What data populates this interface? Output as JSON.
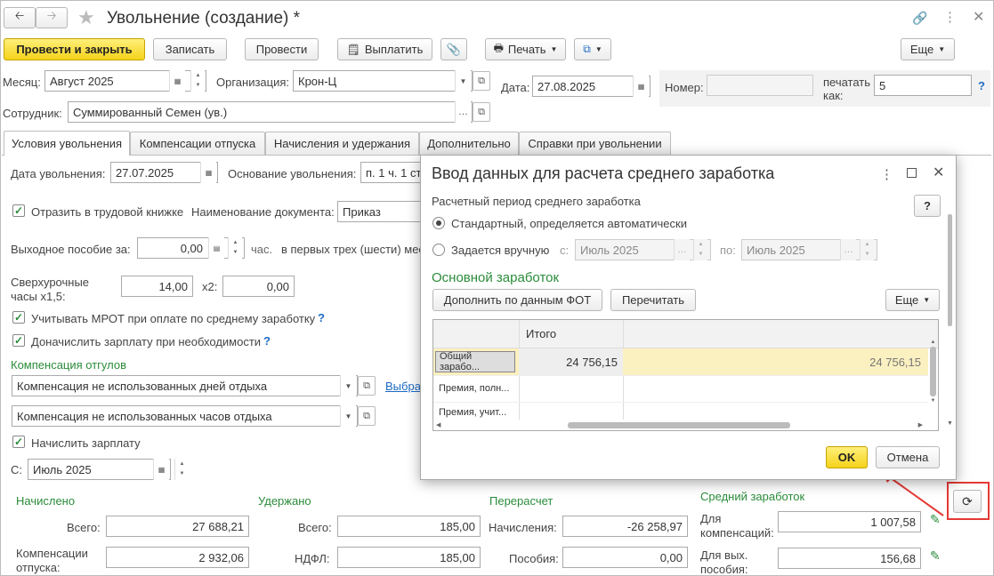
{
  "window": {
    "title": "Увольнение (создание) *"
  },
  "toolbar": {
    "post_close": "Провести и закрыть",
    "save": "Записать",
    "post": "Провести",
    "pay": "Выплатить",
    "print": "Печать",
    "more": "Еще"
  },
  "header": {
    "month_label": "Месяц:",
    "month_value": "Август 2025",
    "org_label": "Организация:",
    "org_value": "Крон-Ц",
    "date_label": "Дата:",
    "date_value": "27.08.2025",
    "number_label": "Номер:",
    "number_value": "",
    "print_as_label1": "печатать",
    "print_as_label2": "как:",
    "print_as_value": "5",
    "help": "?",
    "employee_label": "Сотрудник:",
    "employee_value": "Суммированный Семен (ув.)"
  },
  "tabs": [
    {
      "label": "Условия увольнения"
    },
    {
      "label": "Компенсации отпуска"
    },
    {
      "label": "Начисления и удержания"
    },
    {
      "label": "Дополнительно"
    },
    {
      "label": "Справки при увольнении"
    }
  ],
  "conditions": {
    "dismissal_date_label": "Дата увольнения:",
    "dismissal_date_value": "27.07.2025",
    "basis_label": "Основание увольнения:",
    "basis_value": "п. 1 ч. 1 ст",
    "workbook_label": "Отразить в трудовой книжке",
    "doc_name_label": "Наименование документа:",
    "doc_name_value": "Приказ",
    "severance_label": "Выходное пособие за:",
    "severance_value": "0,00",
    "severance_unit": "час.",
    "severance_tail": "в первых трех (шести) мес",
    "overtime_label1": "Сверхурочные",
    "overtime_label2": "часы x1,5:",
    "overtime_x15": "14,00",
    "x2_label": "x2:",
    "overtime_x2": "0,00",
    "mrot_label": "Учитывать МРОТ при оплате по среднему заработку",
    "topup_label": "Доначислить зарплату при необходимости",
    "comp_title": "Компенсация отгулов",
    "comp_days": "Компенсация не использованных дней отдыха",
    "comp_hours": "Компенсация не использованных часов отдыха",
    "select_link": "Выбра",
    "accrue_label": "Начислить зарплату",
    "from_label": "С:",
    "from_value": "Июль 2025"
  },
  "totals": {
    "accrued_title": "Начислено",
    "total_label": "Всего:",
    "accrued_total": "27 688,21",
    "vac_comp_label1": "Компенсации",
    "vac_comp_label2": "отпуска:",
    "vac_comp_value": "2 932,06",
    "withheld_title": "Удержано",
    "withheld_total": "185,00",
    "ndfl_label": "НДФЛ:",
    "ndfl_value": "185,00",
    "recalc_title": "Перерасчет",
    "recalc_accruals_label": "Начисления:",
    "recalc_accruals_value": "-26 258,97",
    "recalc_benefits_label": "Пособия:",
    "recalc_benefits_value": "0,00",
    "avg_title": "Средний заработок",
    "avg_comp_label1": "Для",
    "avg_comp_label2": "компенсаций:",
    "avg_comp_value": "1 007,58",
    "avg_sev_label1": "Для вых.",
    "avg_sev_label2": "пособия:",
    "avg_sev_value": "156,68"
  },
  "dialog": {
    "title": "Ввод данных для расчета среднего заработка",
    "period_label": "Расчетный период среднего заработка",
    "radio_standard": "Стандартный, определяется автоматически",
    "radio_manual": "Задается вручную",
    "from_label": "с:",
    "from_value": "Июль 2025",
    "to_label": "по:",
    "to_value": "Июль 2025",
    "help": "?",
    "main_earnings": "Основной заработок",
    "fill_btn": "Дополнить по данным ФОТ",
    "recalc_btn": "Перечитать",
    "more_btn": "Еще",
    "grid_header": "Итого",
    "rows": [
      {
        "name": "Общий зарабо...",
        "total": "24 756,15",
        "value": "24 756,15"
      },
      {
        "name": "Премия, полн...",
        "total": "",
        "value": ""
      },
      {
        "name": "Премия, учит...",
        "total": "",
        "value": ""
      }
    ],
    "ok": "OK",
    "cancel": "Отмена"
  },
  "colors": {
    "accent_yellow": "#f5d31b",
    "section_green": "#2a8c3a",
    "highlight_red": "#e53935",
    "row_highlight": "#fbf0c0"
  }
}
